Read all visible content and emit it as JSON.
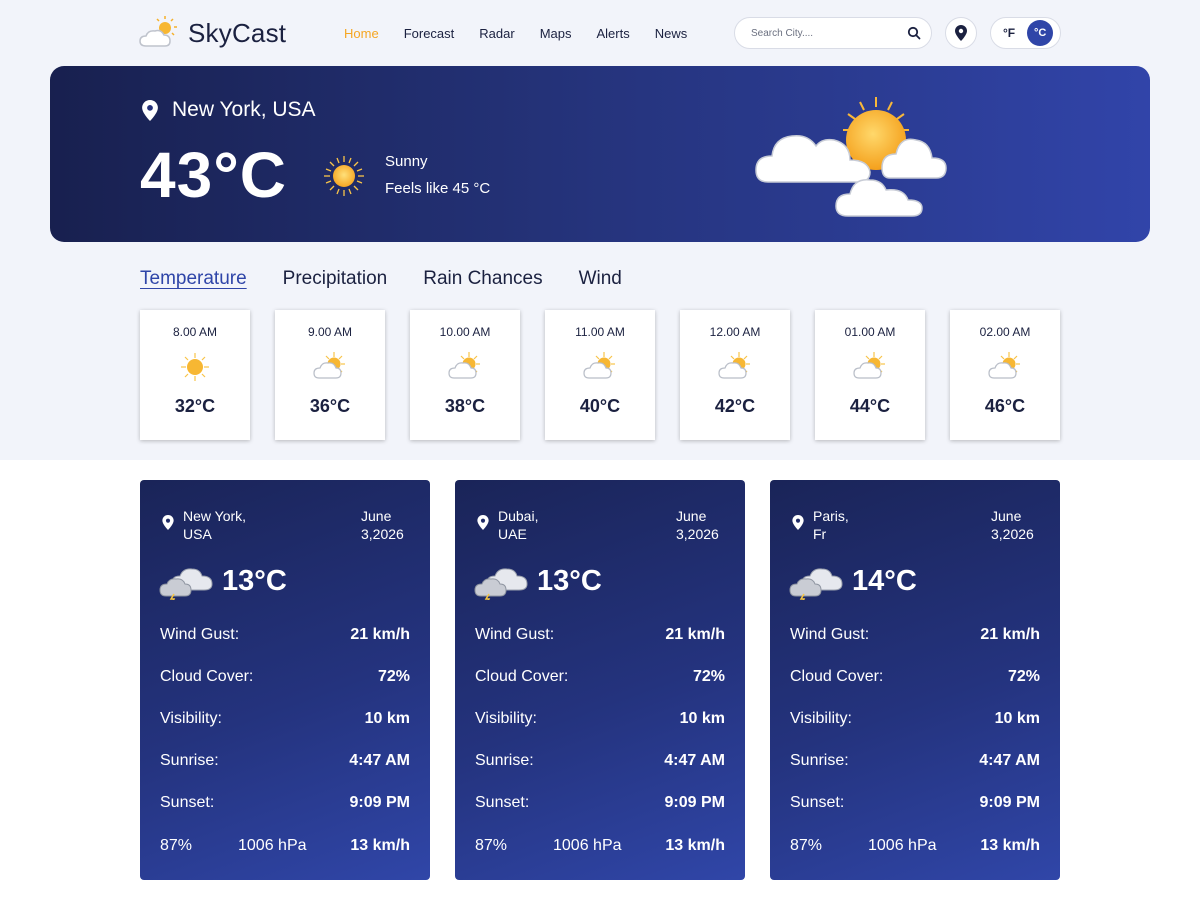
{
  "app": {
    "name": "SkyCast"
  },
  "nav": [
    "Home",
    "Forecast",
    "Radar",
    "Maps",
    "Alerts",
    "News"
  ],
  "search": {
    "placeholder": "Search City...."
  },
  "units": {
    "f": "°F",
    "c": "°C",
    "selected": "°C"
  },
  "hero": {
    "location": "New York, USA",
    "temperature": "43°C",
    "condition": "Sunny",
    "feels_like": "Feels like 45 °C",
    "condition_icon": "sun-icon",
    "illustration": "sun-behind-clouds-illustration"
  },
  "tabs": [
    "Temperature",
    "Precipitation",
    "Rain Chances",
    "Wind"
  ],
  "active_tab": "Temperature",
  "hourly": [
    {
      "time": "8.00 AM",
      "temp": "32°C",
      "icon": "sun-icon"
    },
    {
      "time": "9.00 AM",
      "temp": "36°C",
      "icon": "partly-cloudy-icon"
    },
    {
      "time": "10.00 AM",
      "temp": "38°C",
      "icon": "partly-cloudy-icon"
    },
    {
      "time": "11.00 AM",
      "temp": "40°C",
      "icon": "partly-cloudy-icon"
    },
    {
      "time": "12.00 AM",
      "temp": "42°C",
      "icon": "partly-cloudy-icon"
    },
    {
      "time": "01.00 AM",
      "temp": "44°C",
      "icon": "partly-cloudy-icon"
    },
    {
      "time": "02.00 AM",
      "temp": "46°C",
      "icon": "partly-cloudy-icon"
    }
  ],
  "cities": [
    {
      "loc1": "New York,",
      "loc2": "USA",
      "date1": "June",
      "date2": "3,2026",
      "temp": "13°C",
      "icon": "thunderstorm-icon",
      "wind_gust_label": "Wind Gust:",
      "wind_gust": "21 km/h",
      "cloud_label": "Cloud Cover:",
      "cloud": "72%",
      "vis_label": "Visibility:",
      "vis": "10 km",
      "sunrise_label": "Sunrise:",
      "sunrise": "4:47 AM",
      "sunset_label": "Sunset:",
      "sunset": "9:09 PM",
      "humidity": "87%",
      "pressure": "1006 hPa",
      "wind": "13 km/h"
    },
    {
      "loc1": "Dubai,",
      "loc2": "UAE",
      "date1": "June",
      "date2": "3,2026",
      "temp": "13°C",
      "icon": "thunderstorm-icon",
      "wind_gust_label": "Wind Gust:",
      "wind_gust": "21 km/h",
      "cloud_label": "Cloud Cover:",
      "cloud": "72%",
      "vis_label": "Visibility:",
      "vis": "10 km",
      "sunrise_label": "Sunrise:",
      "sunrise": "4:47 AM",
      "sunset_label": "Sunset:",
      "sunset": "9:09 PM",
      "humidity": "87%",
      "pressure": "1006 hPa",
      "wind": "13 km/h"
    },
    {
      "loc1": "Paris,",
      "loc2": "Fr",
      "date1": "June",
      "date2": "3,2026",
      "temp": "14°C",
      "icon": "thunderstorm-icon",
      "wind_gust_label": "Wind Gust:",
      "wind_gust": "21 km/h",
      "cloud_label": "Cloud Cover:",
      "cloud": "72%",
      "vis_label": "Visibility:",
      "vis": "10 km",
      "sunrise_label": "Sunrise:",
      "sunrise": "4:47 AM",
      "sunset_label": "Sunset:",
      "sunset": "9:09 PM",
      "humidity": "87%",
      "pressure": "1006 hPa",
      "wind": "13 km/h"
    }
  ],
  "colors": {
    "accent": "#2f45a8",
    "nav_active": "#f5a623",
    "hero_dark": "#18204f",
    "hero_light": "#3144a9",
    "page_bg": "#f2f4fa"
  }
}
